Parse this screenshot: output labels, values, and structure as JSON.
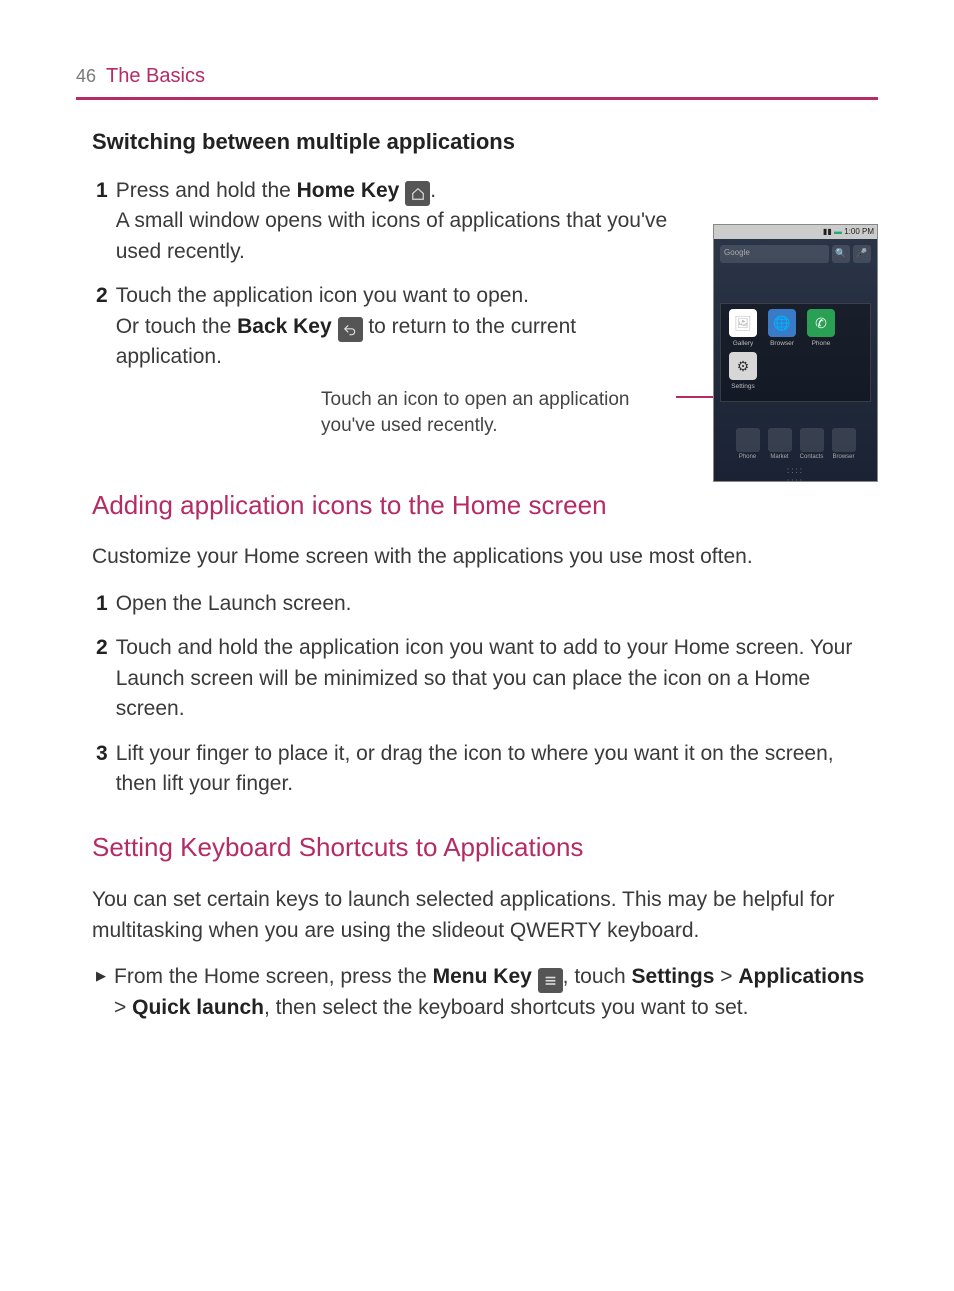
{
  "page": {
    "number": "46",
    "section": "The Basics"
  },
  "switchSection": {
    "title": "Switching between multiple applications",
    "step1": {
      "num": "1",
      "pre": " Press and hold the ",
      "homeKey": "Home Key",
      "post": ".",
      "line2": "A small window opens with icons of applications that you've used recently."
    },
    "step2": {
      "num": "2",
      "line1": " Touch the application icon you want to open.",
      "line2a": "Or touch the ",
      "backKey": "Back Key",
      "line2b": " to return to the current application."
    },
    "callout": "Touch an icon to open an application you've used recently."
  },
  "addingSection": {
    "title": "Adding application icons to the Home screen",
    "intro": "Customize your Home screen with the applications you use most often.",
    "step1": {
      "num": "1",
      "text": " Open the Launch screen."
    },
    "step2": {
      "num": "2",
      "text": " Touch and hold the application icon you want to add to your Home screen. Your Launch screen will be minimized so that you can place the icon on a Home screen."
    },
    "step3": {
      "num": "3",
      "text": " Lift your finger to place it, or drag the icon to where you want it on the screen, then lift your finger."
    }
  },
  "shortcutSection": {
    "title": "Setting Keyboard Shortcuts to Applications",
    "intro": "You can set certain keys to launch selected applications. This may be helpful for multitasking when you are using the slideout QWERTY keyboard.",
    "bullet": {
      "pre": " From the Home screen, press the ",
      "menuKey": "Menu Key",
      "mid1": ", touch ",
      "settings": "Settings",
      "gt1": " > ",
      "applications": "Applications",
      "gt2": " > ",
      "quickLaunch": "Quick launch",
      "post": ", then select the keyboard shortcuts you want to set."
    }
  },
  "phone": {
    "time": "1:00 PM",
    "search": "Google",
    "apps": {
      "gallery": "Gallery",
      "browser": "Browser",
      "phone": "Phone",
      "settings": "Settings"
    },
    "dock": {
      "phone": "Phone",
      "market": "Market",
      "contacts": "Contacts",
      "browser": "Browser"
    }
  }
}
